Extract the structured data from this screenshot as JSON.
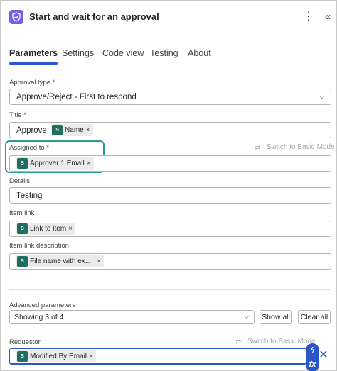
{
  "header": {
    "title": "Start and wait for an approval",
    "more_glyph": "⋮",
    "collapse_glyph": "«",
    "icons": [
      "approval-icon",
      "more-options-icon",
      "collapse-icon"
    ]
  },
  "tabs": [
    {
      "label": "Parameters",
      "active": true
    },
    {
      "label": "Settings",
      "active": false
    },
    {
      "label": "Code view",
      "active": false
    },
    {
      "label": "Testing",
      "active": false
    },
    {
      "label": "About",
      "active": false
    }
  ],
  "form": {
    "approval_type": {
      "label": "Approval type",
      "required": "*",
      "value": "Approve/Reject - First to respond"
    },
    "title": {
      "label": "Title",
      "required": "*",
      "prefix": "Approve:",
      "token": "Name"
    },
    "assigned_to": {
      "label": "Assigned to",
      "required": "*",
      "token": "Approver 1 Email",
      "switch_label": "Switch to Basic Mode"
    },
    "details": {
      "label": "Details",
      "value": "Testing"
    },
    "item_link": {
      "label": "Item link",
      "token": "Link to item"
    },
    "item_link_description": {
      "label": "Item link description",
      "token": "File name with ex..."
    },
    "advanced": {
      "label": "Advanced parameters",
      "selected": "Showing 3 of 4",
      "show_all": "Show all",
      "clear_all": "Clear all"
    },
    "requestor": {
      "label": "Requestor",
      "token": "Modified By Email",
      "switch_label": "Switch to Basic Mode"
    }
  },
  "glyphs": {
    "remove": "×",
    "chevron": "⌵",
    "close": "✕",
    "fx": "fx",
    "bolt": "ϟ"
  },
  "colors": {
    "accent": "#2b56c9",
    "app_icon": "#7b5ee6",
    "highlight": "#2a9d8f",
    "token_icon": "#1f6e5f"
  }
}
